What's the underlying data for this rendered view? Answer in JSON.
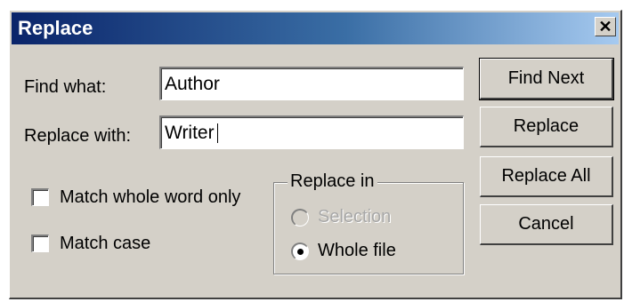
{
  "window": {
    "title": "Replace",
    "close_glyph": "✕"
  },
  "find": {
    "label": "Find what:",
    "value": "Author"
  },
  "replace": {
    "label": "Replace with:",
    "value": "Writer"
  },
  "options": {
    "match_whole_word": {
      "label": "Match whole word only",
      "checked": false
    },
    "match_case": {
      "label": "Match case",
      "checked": false
    }
  },
  "replace_in": {
    "legend": "Replace in",
    "selection": {
      "label": "Selection",
      "selected": false,
      "enabled": false
    },
    "whole_file": {
      "label": "Whole file",
      "selected": true,
      "enabled": true
    }
  },
  "buttons": {
    "find_next": "Find Next",
    "replace": "Replace",
    "replace_all": "Replace All",
    "cancel": "Cancel"
  }
}
